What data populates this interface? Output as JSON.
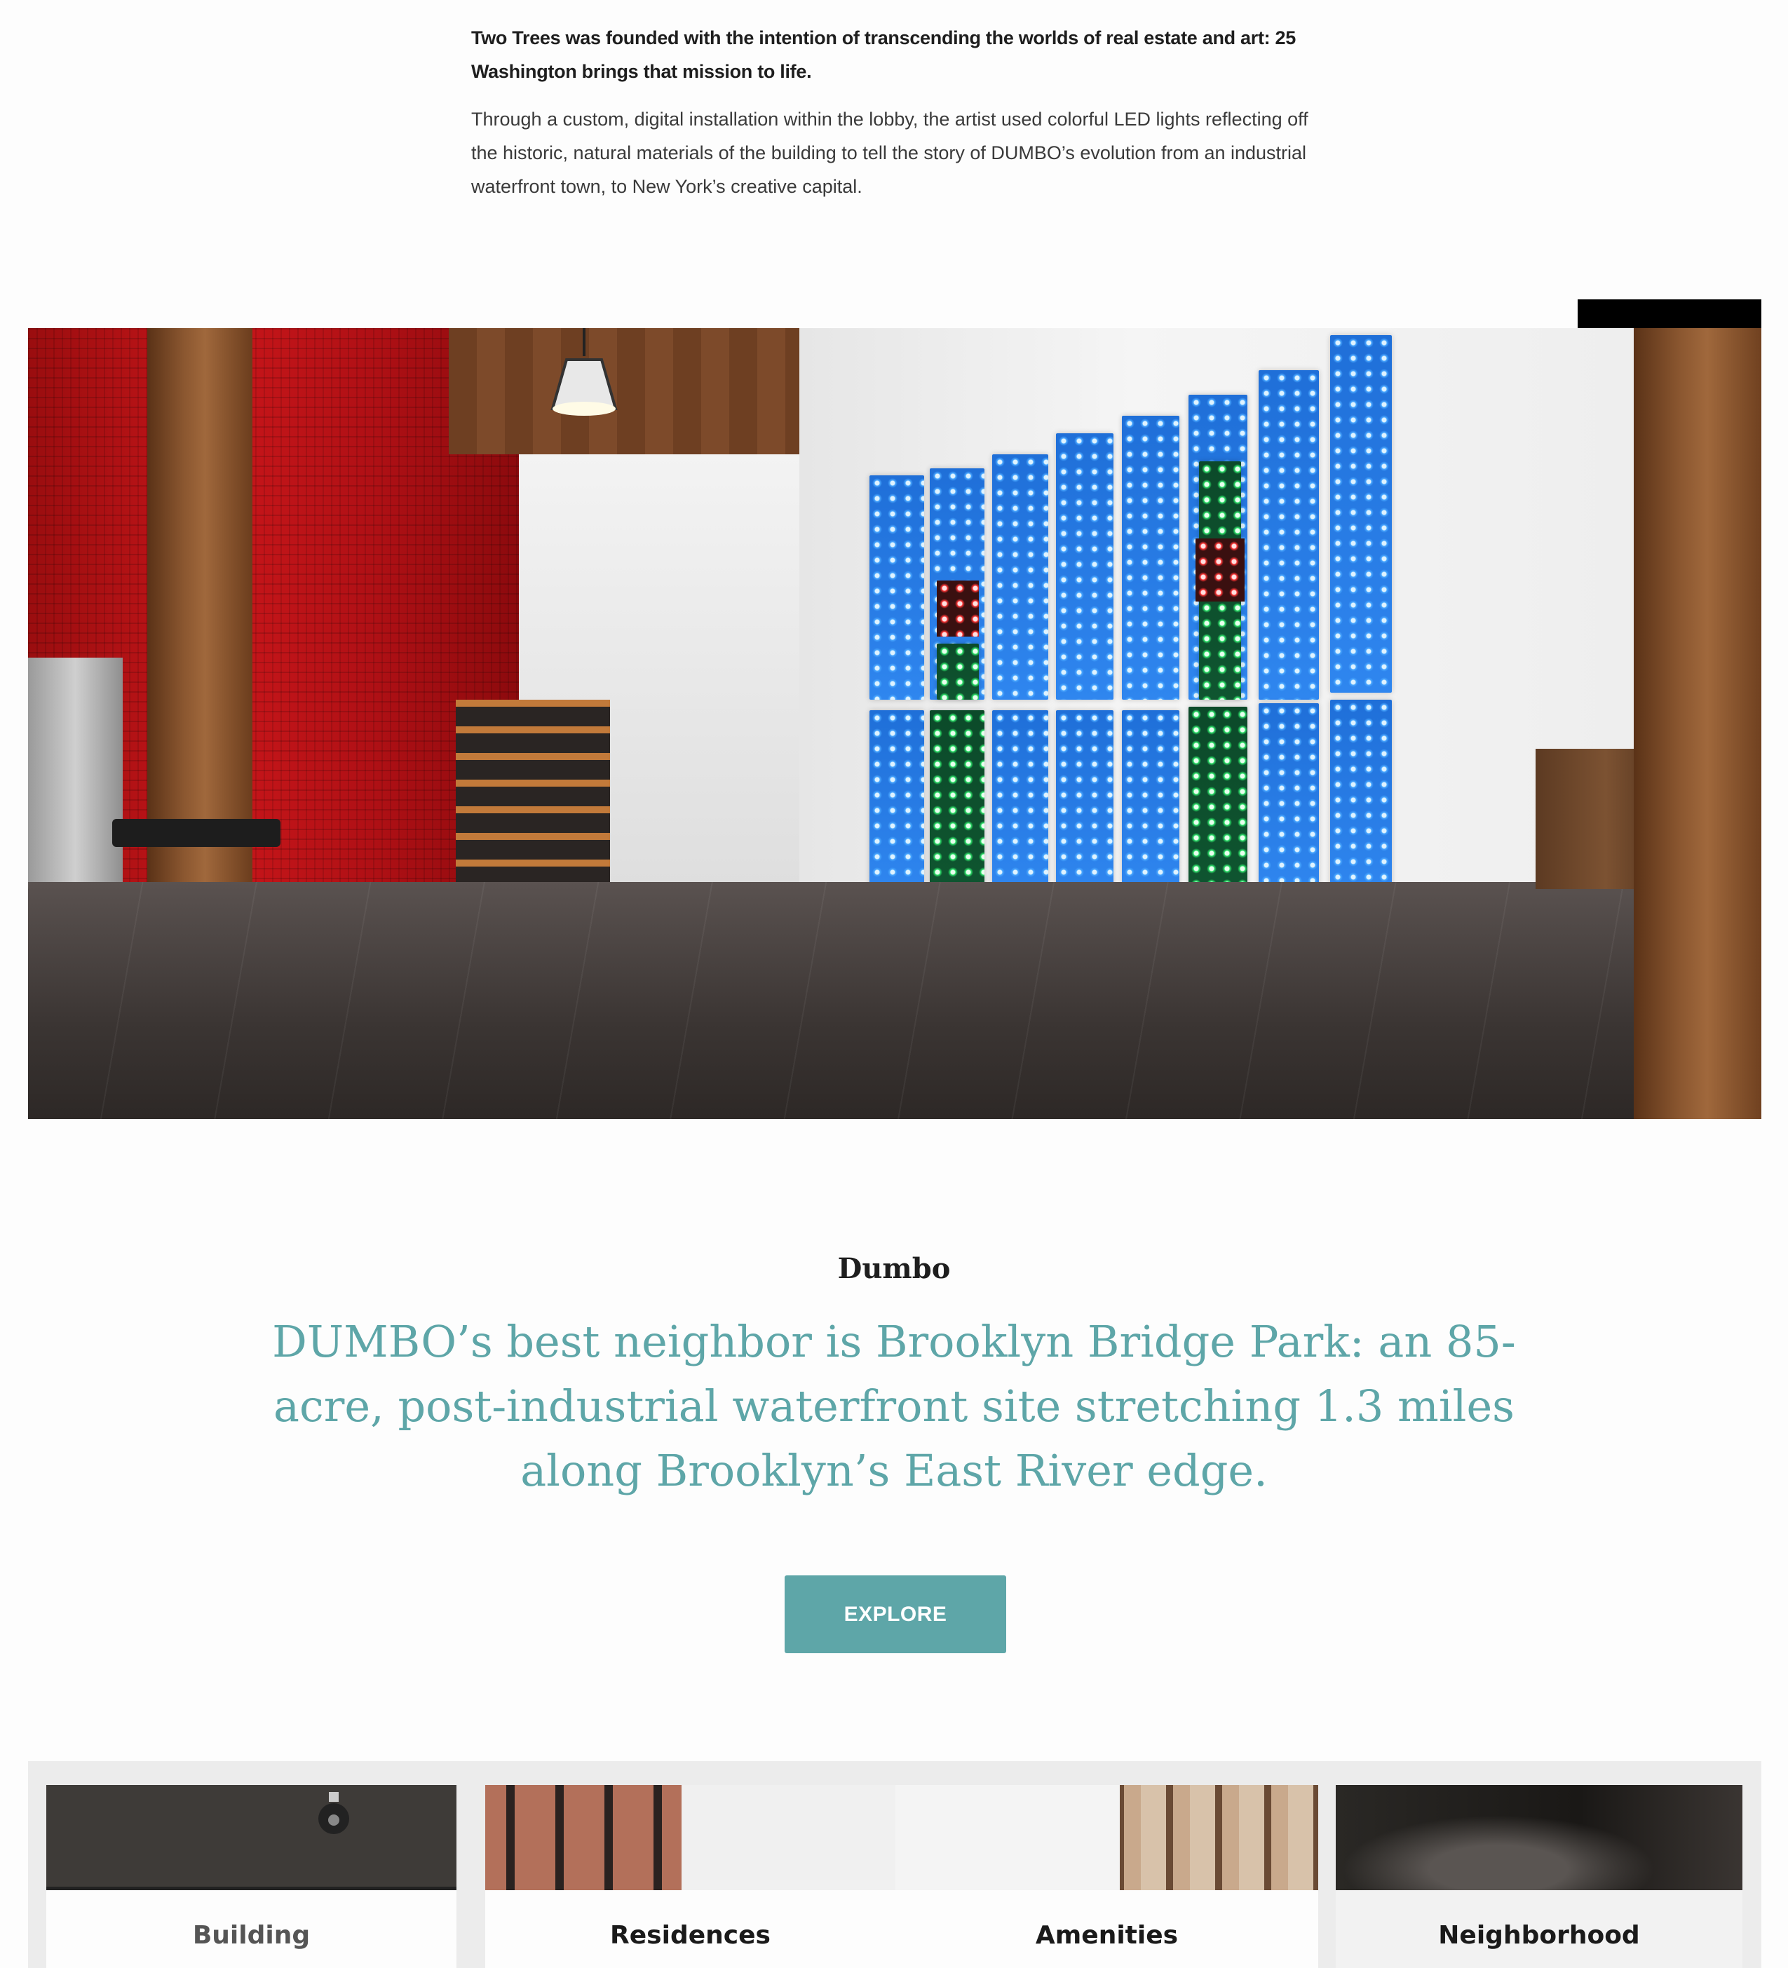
{
  "intro": {
    "lead": "Two Trees was founded with the intention of transcending the worlds of real estate and art: 25 Washington brings that mission to life.",
    "body": "Through a custom, digital installation within the lobby, the artist used colorful LED lights reflecting off the historic, natural materials of the building to tell the story of DUMBO’s evolution from an industrial waterfront town, to New York’s creative capital."
  },
  "dumbo": {
    "label": "Dumbo",
    "quote": "DUMBO’s best neighbor is Brooklyn Bridge Park: an 85-acre, post-industrial waterfront site stretching 1.3 miles along Brooklyn’s East River edge.",
    "button": "EXPLORE"
  },
  "nav_cards": [
    {
      "label": "Building"
    },
    {
      "label": "Residences"
    },
    {
      "label": "Amenities"
    },
    {
      "label": "Neighborhood"
    }
  ],
  "colors": {
    "accent": "#5ea6a8",
    "text": "#1e1e1e",
    "card_bg": "#ececec"
  }
}
